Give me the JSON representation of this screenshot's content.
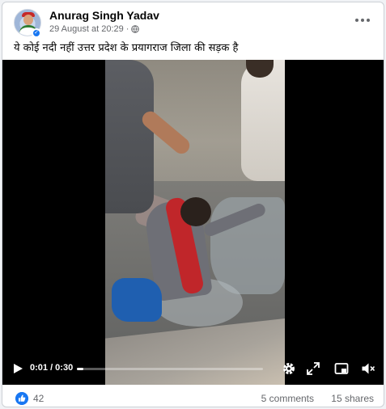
{
  "post": {
    "author": "Anurag Singh Yadav",
    "timestamp": "29 August at 20:29",
    "separator": "·",
    "audience_icon": "globe-icon",
    "more_icon": "more-options-icon",
    "caption": "ये कोई नदी नहीं उत्तर प्रदेश के प्रयागराज जिला की सड़क है"
  },
  "video": {
    "current_time": "0:01",
    "duration": "0:30",
    "time_display": "0:01 / 0:30",
    "progress_fraction": 0.033,
    "controls": [
      "play-icon",
      "settings-icon",
      "fullscreen-icon",
      "picture-in-picture-icon",
      "volume-muted-icon"
    ]
  },
  "engagement": {
    "reaction_icon": "like-icon",
    "reaction_count": "42",
    "comments": "5 comments",
    "shares": "15 shares"
  },
  "colors": {
    "accent": "#1877f2",
    "secondary_text": "#65676b",
    "card_background": "#ffffff",
    "page_background": "#f0f2f5"
  }
}
